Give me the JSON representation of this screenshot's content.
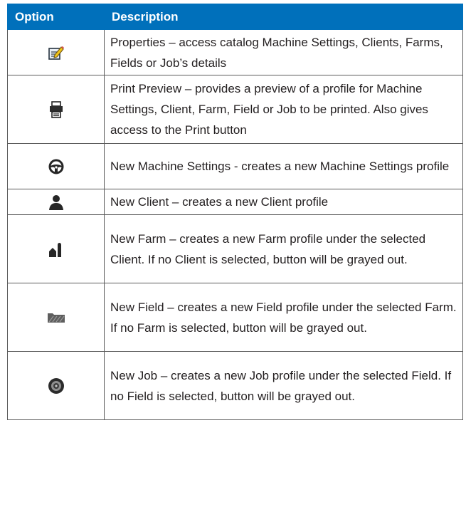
{
  "table": {
    "headers": {
      "option": "Option",
      "description": "Description"
    },
    "rows": [
      {
        "icon": "properties-icon",
        "description": "Properties – access catalog Machine Settings, Clients, Farms, Fields or Job’s details"
      },
      {
        "icon": "print-preview-icon",
        "description": "Print Preview – provides a preview of a profile for Machine Settings, Client, Farm, Field or Job to be printed. Also gives access to the Print button"
      },
      {
        "icon": "steering-wheel-icon",
        "description": "New Machine Settings - creates a new Machine Settings profile"
      },
      {
        "icon": "person-icon",
        "description": "New Client – creates a new Client profile"
      },
      {
        "icon": "farm-icon",
        "description": "New Farm – creates a new Farm profile under the selected Client. If no Client is selected, button will be grayed out."
      },
      {
        "icon": "field-icon",
        "description": "New Field – creates a new Field profile under the selected Farm. If no Farm is selected, button will be grayed out."
      },
      {
        "icon": "job-icon",
        "description": "New Job – creates a new Job profile under the selected Field. If no Field is selected, button will be grayed out."
      }
    ]
  }
}
